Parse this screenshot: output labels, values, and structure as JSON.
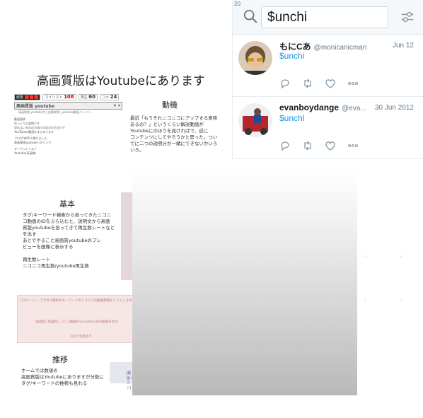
{
  "slide": {
    "title": "高画質版はYoutubeにあります",
    "mini": {
      "stat1_label": "総数",
      "stat1_value": "",
      "stat2_label": "マイリスト",
      "stat2_value": "108",
      "stat3_label": "再生",
      "stat3_value": "60",
      "stat4_label": "コメ",
      "stat4_value": "24",
      "search_label": "高画質版 youtube",
      "sub": "高画質版 youtubeから自動取得しyoutube動画ページへ",
      "lines": [
        "動画説明",
        "ゆっくりと説明です",
        "見れない方のの方向けの見方の方法です",
        "YouTubeの動画をまとめてます",
        "ブログ(WIP)で帰りました",
        "高画質版youtubeへのリンク",
        "ターゲットリスト",
        "Youtube(高画質)"
      ]
    },
    "sections": {
      "motive_title": "動機",
      "motive_text": "最近「もうそれニコニコにアップする意味\nあるの？」というくらい解説動画が\nYoutubeにのほうを見ければで、逆に\nコンテンツにしてやろうかと思った。つい\nでに二つの説明分が一緒にできないかいろ\nいろ。",
      "basic_title": "基本",
      "basic_text": "タグ/キーワード検索から拾ってきたニコニ\nコ動画のIDをぶら込むと、説明文から高画\n質版youtubeを拾ってきて再生数レートなど\nを出す\nあとでやること高画質youtubeのプレ\nビューを画像に表示する\n\n再生数レート\nニコニコ再生数/youtube再生数",
      "trans_title": "推移",
      "trans_text": "ホームでは数値の\n高画質版はYoutubeにありますが分数に\nタグ/キーワードの推移も見れる"
    },
    "pink": {
      "line1": "[ログイン] ・アクセス解析のキーワードのニコニコの動画情報をリストします",
      "line2": "[高画質] 高画質ニコニコ動画のyoutube公式の動画を見る",
      "line3": "2017 年歴あり"
    },
    "blue": {
      "text": "[動画リスト]"
    }
  },
  "twitter": {
    "count": "20",
    "search_value": "$unchi",
    "tweets": [
      {
        "name": "もにCあ",
        "handle": "@monicanicman",
        "date": "Jun 12",
        "text": "$unchi"
      },
      {
        "name": "evanboydange",
        "handle": "@eva...",
        "date": "30 Jun 2012",
        "text": "$unchl"
      }
    ]
  },
  "icons": {
    "search": "search-icon",
    "filter": "filter-icon",
    "reply": "reply-icon",
    "retweet": "retweet-icon",
    "like": "heart-icon",
    "more": "more-icon"
  },
  "colors": {
    "link": "#1b95e0",
    "icon": "#657786"
  }
}
